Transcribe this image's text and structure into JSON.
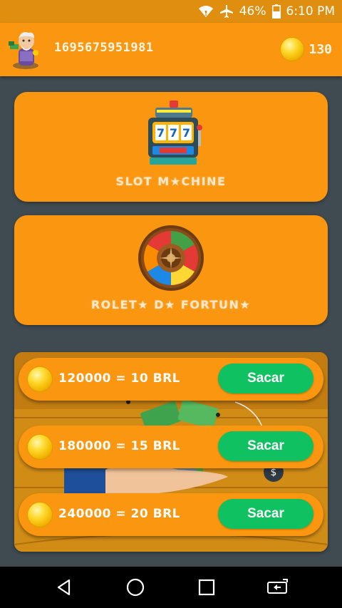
{
  "status_bar": {
    "battery": "46%",
    "time": "6:10 PM",
    "icons": [
      "wifi-icon",
      "airplane-icon",
      "battery-icon"
    ]
  },
  "header": {
    "user_id": "1695675951981",
    "coins": "130",
    "avatar": "avatar-icon"
  },
  "games": [
    {
      "label": "SLOT M★CHINE",
      "icon": "slot-machine-icon"
    },
    {
      "label": "ROLET★ D★ FORTUN★",
      "icon": "fortune-wheel-icon"
    }
  ],
  "offers": [
    {
      "text": "120000 = 10 BRL",
      "button": "Sacar"
    },
    {
      "text": "180000 = 15 BRL",
      "button": "Sacar"
    },
    {
      "text": "240000 = 20 BRL",
      "button": "Sacar"
    }
  ],
  "colors": {
    "header": "#fb9610",
    "background": "#3f4a51",
    "button": "#0fc160"
  },
  "nav": [
    "back-icon",
    "home-icon",
    "recents-icon",
    "screen-rotate-icon"
  ]
}
